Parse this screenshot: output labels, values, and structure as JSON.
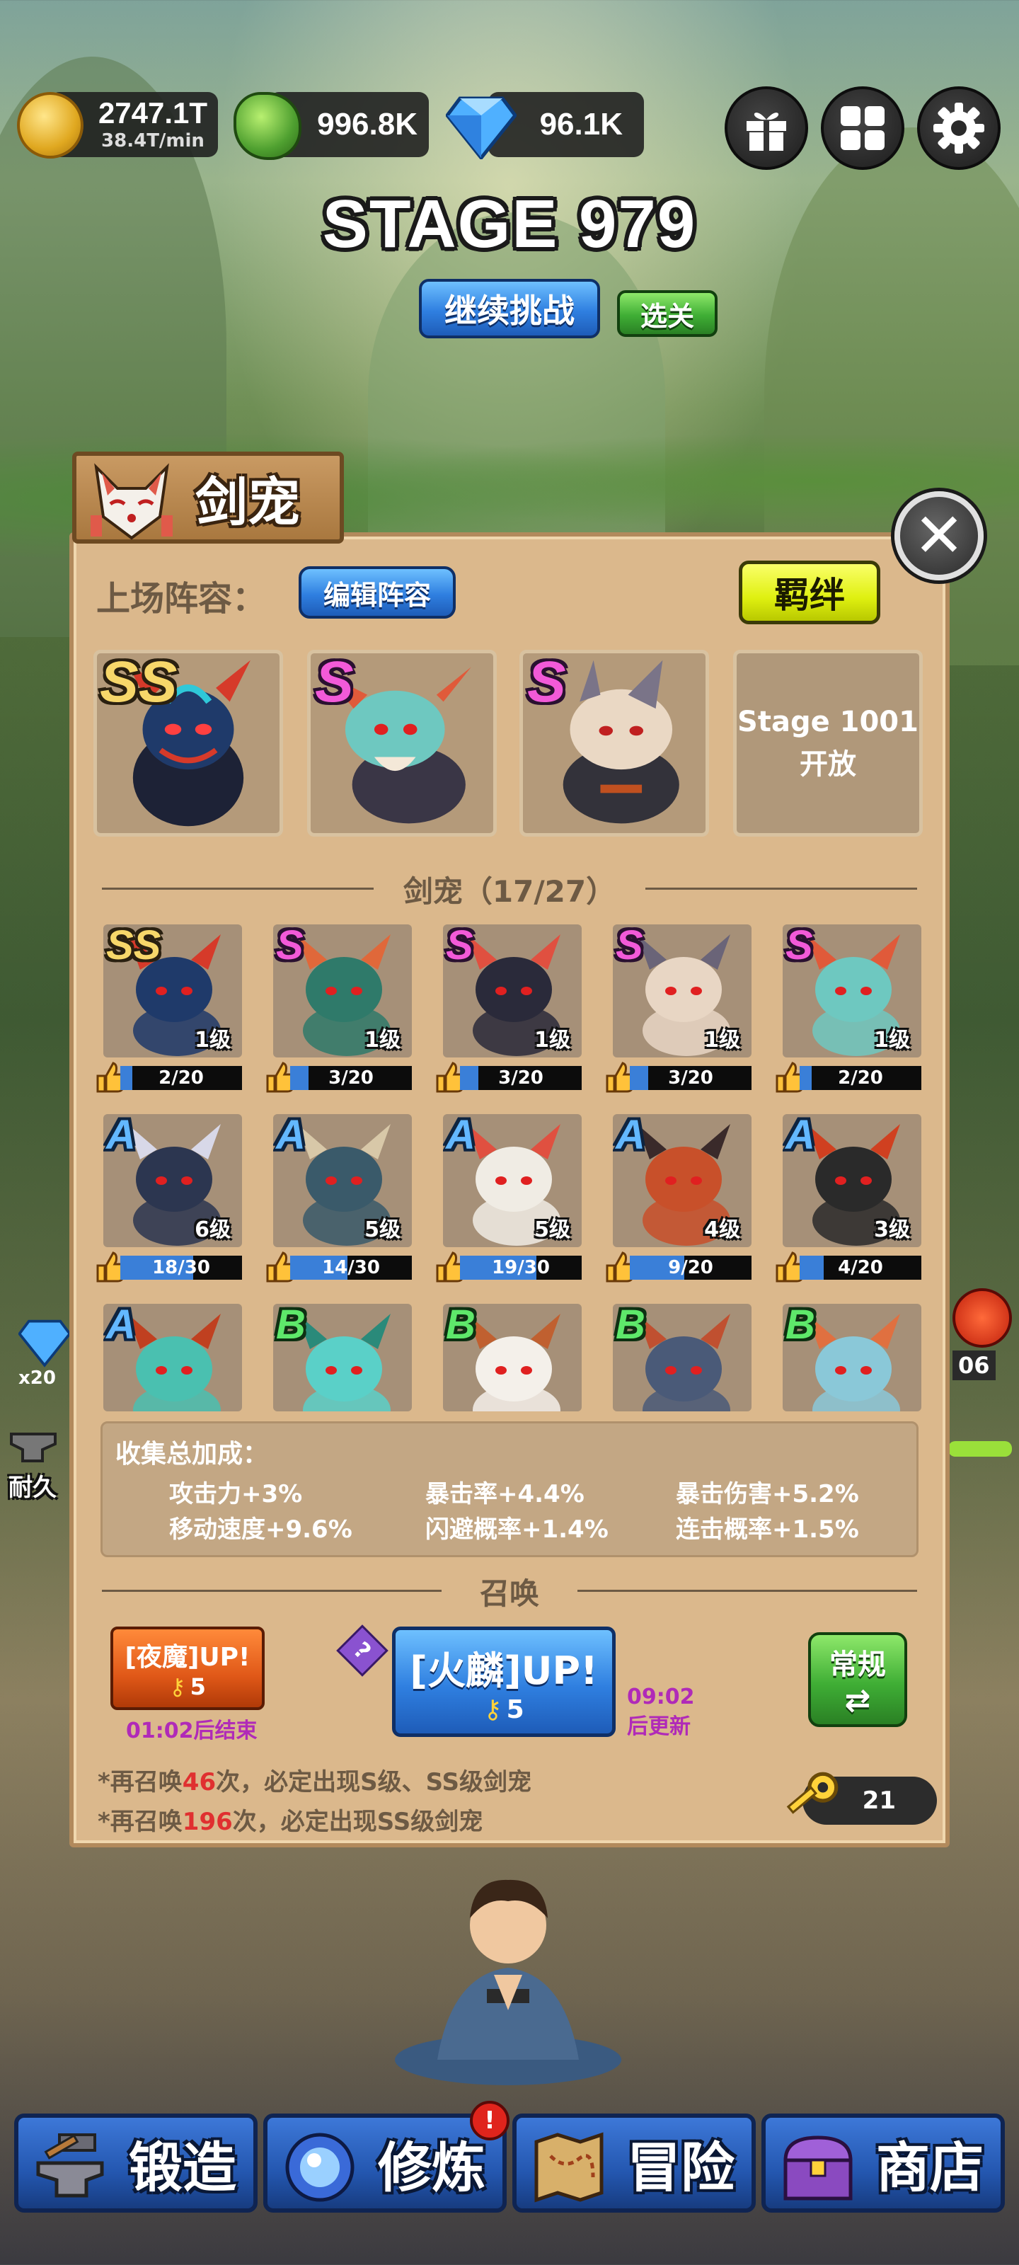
{
  "currency": {
    "gold_amount": "2747.1T",
    "gold_rate": "38.4T/min",
    "jade_amount": "996.8K",
    "gem_amount": "96.1K"
  },
  "top_icons": [
    "gift-icon",
    "grid-menu-icon",
    "settings-gear-icon"
  ],
  "stage": {
    "title": "STAGE 979",
    "continue_label": "继续挑战",
    "select_label": "选关"
  },
  "panel": {
    "title": "剑宠",
    "lineup_label": "上场阵容：",
    "edit_lineup_label": "编辑阵容",
    "bond_label": "羁绊",
    "lineup_slots": [
      {
        "rank": "SS"
      },
      {
        "rank": "S"
      },
      {
        "rank": "S"
      }
    ],
    "locked_slot_line1": "Stage 1001",
    "locked_slot_line2": "开放",
    "collection_title": "剑宠（17/27）",
    "pets": [
      {
        "rank": "SS",
        "level": "1级",
        "progress": "2/20",
        "ratio": 0.1
      },
      {
        "rank": "S",
        "level": "1级",
        "progress": "3/20",
        "ratio": 0.15
      },
      {
        "rank": "S",
        "level": "1级",
        "progress": "3/20",
        "ratio": 0.15
      },
      {
        "rank": "S",
        "level": "1级",
        "progress": "3/20",
        "ratio": 0.15
      },
      {
        "rank": "S",
        "level": "1级",
        "progress": "2/20",
        "ratio": 0.1
      },
      {
        "rank": "A",
        "level": "6级",
        "progress": "18/30",
        "ratio": 0.6
      },
      {
        "rank": "A",
        "level": "5级",
        "progress": "14/30",
        "ratio": 0.4667
      },
      {
        "rank": "A",
        "level": "5级",
        "progress": "19/30",
        "ratio": 0.6333
      },
      {
        "rank": "A",
        "level": "4级",
        "progress": "9/20",
        "ratio": 0.45
      },
      {
        "rank": "A",
        "level": "3级",
        "progress": "4/20",
        "ratio": 0.2
      },
      {
        "rank": "A"
      },
      {
        "rank": "B"
      },
      {
        "rank": "B"
      },
      {
        "rank": "B"
      },
      {
        "rank": "B"
      }
    ],
    "bonus": {
      "header": "收集总加成：",
      "items": [
        "攻击力+3%",
        "暴击率+4.4%",
        "暴击伤害+5.2%",
        "移动速度+9.6%",
        "闪避概率+1.4%",
        "连击概率+1.5%"
      ]
    },
    "summon": {
      "title": "召唤",
      "event1_label": "[夜魔]UP!",
      "event1_cost": "5",
      "event1_timer": "01:02后结束",
      "help_label": "?",
      "event2_label": "[火麟]UP!",
      "event2_cost": "5",
      "event2_timer1": "09:02",
      "event2_timer2": "后更新",
      "normal_label": "常规",
      "note1_prefix": "*再召唤",
      "note1_count": "46",
      "note1_suffix": "次，必定出现S级、SS级剑宠",
      "note2_prefix": "*再召唤",
      "note2_count": "196",
      "note2_suffix": "次，必定出现SS级剑宠",
      "keys": "21"
    }
  },
  "side": {
    "left_badge": "x20",
    "left_label": "耐久",
    "right_badge": "06"
  },
  "bottom_nav": [
    {
      "label": "锻造",
      "icon": "anvil-hammer-icon"
    },
    {
      "label": "修炼",
      "icon": "orb-icon"
    },
    {
      "label": "冒险",
      "icon": "map-icon"
    },
    {
      "label": "商店",
      "icon": "treasure-chest-icon"
    }
  ],
  "notification_badge": "!",
  "colors": {
    "panel_bg": "#dbb88c",
    "rank_ss": "#f7d76a",
    "rank_s": "#f25ad8",
    "rank_a": "#63b8ff",
    "rank_b": "#5ee86a",
    "progress_fill": "#3a7fd8",
    "nav_blue": "#2457b0",
    "bond_yellow": "#dff010"
  }
}
